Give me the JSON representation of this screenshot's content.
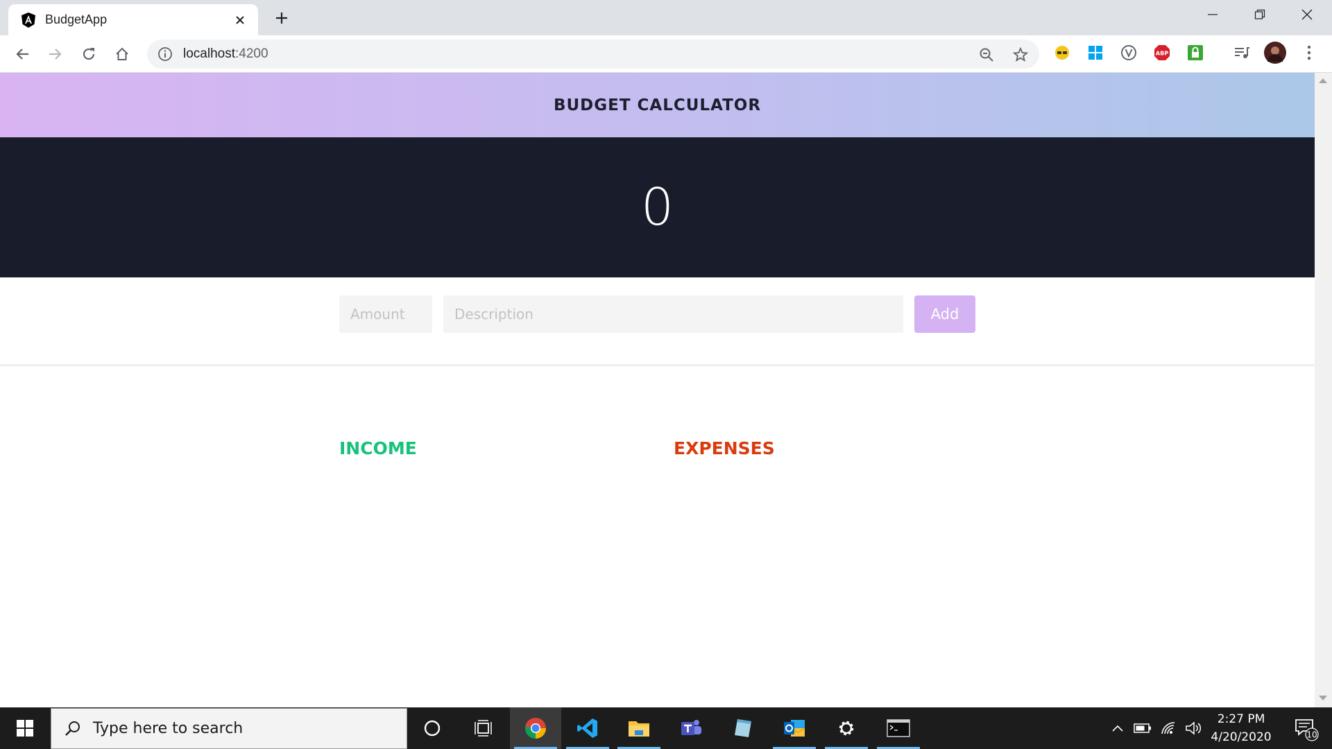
{
  "browser": {
    "tab_title": "BudgetApp",
    "url_host": "localhost",
    "url_port": ":4200"
  },
  "app": {
    "header_title": "BUDGET CALCULATOR",
    "balance": "0",
    "amount_placeholder": "Amount",
    "description_placeholder": "Description",
    "add_label": "Add",
    "income_title": "INCOME",
    "expenses_title": "EXPENSES",
    "colors": {
      "header_gradient": [
        "#d8b4f2",
        "#abc8e8"
      ],
      "balance_bg": "#181c2b",
      "add_button": "#d4b2f3",
      "income": "#17c27a",
      "expenses": "#d93b0f"
    }
  },
  "taskbar": {
    "search_placeholder": "Type here to search",
    "time": "2:27 PM",
    "date": "4/20/2020",
    "notification_count": "10",
    "pinned": [
      "cortana-icon",
      "task-view-icon",
      "chrome-icon",
      "vscode-icon",
      "file-explorer-icon",
      "teams-icon",
      "notepad-icon",
      "outlook-icon",
      "settings-icon",
      "terminal-icon"
    ]
  }
}
